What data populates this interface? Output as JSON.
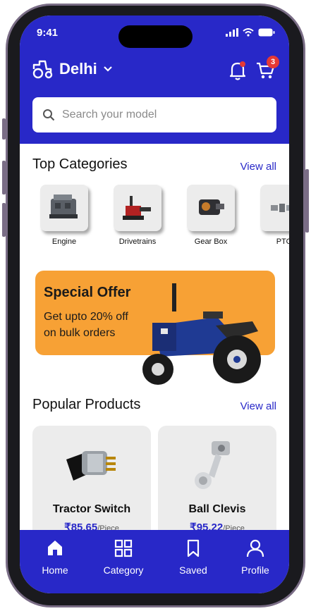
{
  "status": {
    "time": "9:41"
  },
  "header": {
    "location": "Delhi",
    "cart_count": "3"
  },
  "search": {
    "placeholder": "Search your model"
  },
  "categories": {
    "title": "Top Categories",
    "view_all": "View all",
    "items": [
      {
        "label": "Engine"
      },
      {
        "label": "Drivetrains"
      },
      {
        "label": "Gear Box"
      },
      {
        "label": "PTO"
      }
    ]
  },
  "offer": {
    "title": "Special Offer",
    "line1": "Get upto 20% off",
    "line2": "on bulk orders"
  },
  "popular": {
    "title": "Popular Products",
    "view_all": "View all",
    "items": [
      {
        "name": "Tractor Switch",
        "price": "₹85.65",
        "unit": "/Piece"
      },
      {
        "name": "Ball Clevis",
        "price": "₹95.22",
        "unit": "/Piece"
      }
    ]
  },
  "nav": {
    "items": [
      {
        "label": "Home",
        "icon": "home-icon"
      },
      {
        "label": "Category",
        "icon": "grid-icon"
      },
      {
        "label": "Saved",
        "icon": "bookmark-icon"
      },
      {
        "label": "Profile",
        "icon": "user-icon"
      }
    ]
  },
  "colors": {
    "primary": "#2828C8",
    "offer_bg": "#F7A135",
    "badge": "#E53935"
  }
}
